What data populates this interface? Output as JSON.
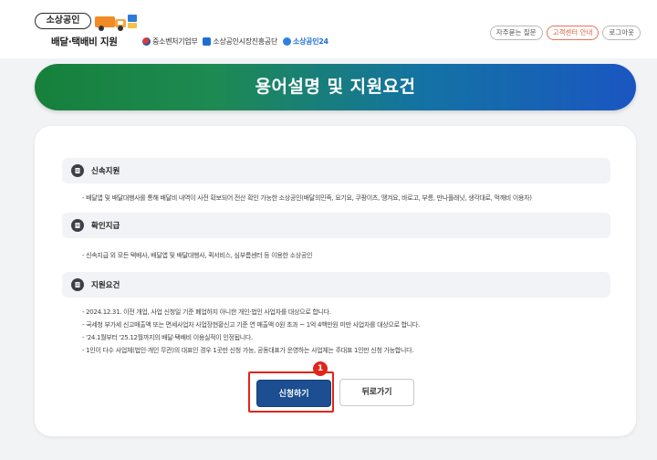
{
  "header": {
    "brand_pill": "소상공인",
    "brand_sub": "배달·택배비 지원",
    "partners": [
      "중소벤처기업부",
      "소상공인시장진흥공단",
      "소상공인24"
    ],
    "util_buttons": [
      "자주묻는 질문",
      "고객센터 안내",
      "로그아웃"
    ]
  },
  "banner": {
    "title": "용어설명 및 지원요건"
  },
  "sections": [
    {
      "title": "신속지원",
      "bullets": [
        "배달앱 및 배달대행사를 통해 배달비 내역이 사전 확보되어 전산 확인 가능한 소상공인(배달의민족, 요기요, 쿠팡이츠, 땡겨요, 바로고, 부릉, 만나플래닛, 생각대로, 먹깨비 이용자)"
      ]
    },
    {
      "title": "확인지급",
      "bullets": [
        "신속지급 외 모든 택배사, 배달앱 및 배달대행사, 퀵서비스, 심부름센터 등 이용한 소상공인"
      ]
    },
    {
      "title": "지원요건",
      "bullets": [
        "2024.12.31. 이전 개업, 사업 신청일 기준 폐업하지 아니한 개인·법인 사업자를 대상으로 합니다.",
        "국세청 부가세 신고매출액 또는 면세사업자 사업장현황신고 기준 연 매출액 0원 초과 ~ 1억 4백만원 미만 사업자를 대상으로 합니다.",
        "'24.1월부터 '25.12월까지의 배달·택배비 이용실적이 인정됩니다.",
        "1인이 다수 사업체(법인·개인 무관)의 대표인 경우 1곳만 신청 가능, 공동대표가 운영하는 사업체는 주대표 1인만 신청 가능합니다."
      ]
    }
  ],
  "actions": {
    "apply_label": "신청하기",
    "back_label": "뒤로가기",
    "step_number": "1"
  },
  "colors": {
    "banner_start": "#16803c",
    "banner_end": "#1a56c2",
    "primary_button": "#1c4e91",
    "highlight": "#e0261b"
  },
  "icons": [
    "truck-icon",
    "document-icon"
  ]
}
